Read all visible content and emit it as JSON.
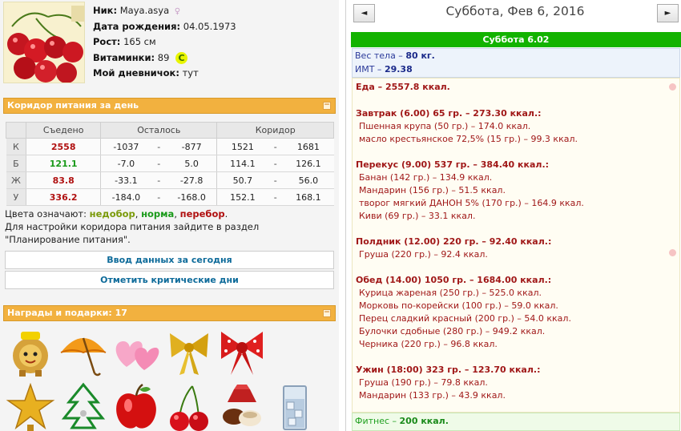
{
  "profile": {
    "nick_label": "Ник:",
    "nick": "Maya.asya",
    "birth_label": "Дата рождения:",
    "birth": "04.05.1973",
    "height_label": "Рост:",
    "height": "165 см",
    "vitamins_label": "Витаминки:",
    "vitamins": "89",
    "vitamin_badge": "C",
    "diary_label": "Мой дневничок:",
    "diary": "тут"
  },
  "corridor": {
    "title": "Коридор питания за день",
    "headers": [
      "",
      "Съедено",
      "Осталось",
      "Коридор"
    ],
    "rows": [
      {
        "letter": "К",
        "eaten": "2558",
        "color": "#b01010",
        "left_min": "-1037",
        "left_max": "-877",
        "corr_min": "1521",
        "corr_max": "1681"
      },
      {
        "letter": "Б",
        "eaten": "121.1",
        "color": "#1a9a1a",
        "left_min": "-7.0",
        "left_max": "5.0",
        "corr_min": "114.1",
        "corr_max": "126.1"
      },
      {
        "letter": "Ж",
        "eaten": "83.8",
        "color": "#b01010",
        "left_min": "-33.1",
        "left_max": "-27.8",
        "corr_min": "50.7",
        "corr_max": "56.0"
      },
      {
        "letter": "У",
        "eaten": "336.2",
        "color": "#b01010",
        "left_min": "-184.0",
        "left_max": "-168.0",
        "corr_min": "152.1",
        "corr_max": "168.1"
      }
    ],
    "dash": "-",
    "legend_prefix": "Цвета означают:",
    "legend_low": "недобор",
    "legend_norm": "норма",
    "legend_over": "перебор",
    "legend_note": "Для настройки коридора питания зайдите в раздел \"Планирование питания\".",
    "btn_input": "Ввод данных за сегодня",
    "btn_critical": "Отметить критические дни"
  },
  "awards": {
    "title": "Награды и подарки: 17"
  },
  "day": {
    "date_title": "Суббота, Фев 6, 2016",
    "prev_icon": "◄",
    "next_icon": "►",
    "day_header": "Суббота 6.02",
    "weight_label": "Вес тела –",
    "weight": "80 кг.",
    "bmi_label": "ИМТ –",
    "bmi": "29.38",
    "food_total": "Еда – 2557.8 ккал.",
    "meals": [
      {
        "head": "Завтрак (6.00) 65 гр. – 273.30 ккал.:",
        "items": [
          "Пшенная крупа (50 гр.) – 174.0 ккал.",
          "масло крестьянское 72,5% (15 гр.) – 99.3 ккал."
        ]
      },
      {
        "head": "Перекус (9.00) 537 гр. – 384.40 ккал.:",
        "items": [
          "Банан (142 гр.) – 134.9 ккал.",
          "Мандарин (156 гр.) – 51.5 ккал.",
          "творог мягкий ДАНОН 5% (170 гр.) – 164.9 ккал.",
          "Киви (69 гр.) – 33.1 ккал."
        ]
      },
      {
        "head": "Полдник (12.00) 220 гр. – 92.40 ккал.:",
        "items": [
          "Груша (220 гр.) – 92.4 ккал."
        ]
      },
      {
        "head": "Обед (14.00) 1050 гр. – 1684.00 ккал.:",
        "items": [
          "Курица жареная (250 гр.) – 525.0 ккал.",
          "Морковь по-корейски (100 гр.) – 59.0 ккал.",
          "Перец сладкий красный (200 гр.) – 54.0 ккал.",
          "Булочки сдобные (280 гр.) – 949.2 ккал.",
          "Черника (220 гр.) – 96.8 ккал."
        ]
      },
      {
        "head": "Ужин (18:00) 323 гр. – 123.70 ккал.:",
        "items": [
          "Груша (190 гр.) – 79.8 ккал.",
          "Мандарин (133 гр.) – 43.9 ккал."
        ]
      }
    ],
    "fitness_label": "Фитнес –",
    "fitness": "200 ккал."
  }
}
